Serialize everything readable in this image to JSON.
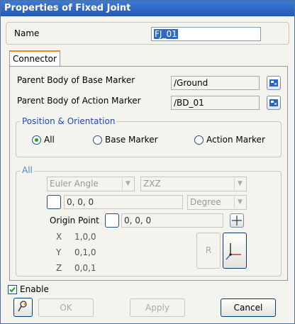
{
  "window": {
    "title": "Properties of Fixed Joint"
  },
  "name_label": "Name",
  "name_value": "FJ_01",
  "tab": "Connector",
  "parent_base_label": "Parent Body of Base Marker",
  "parent_base_value": "/Ground",
  "parent_action_label": "Parent Body of Action Marker",
  "parent_action_value": "/BD_01",
  "position_group": "Position & Orientation",
  "radio_all": "All",
  "radio_base": "Base Marker",
  "radio_action": "Action Marker",
  "all_group": "All",
  "euler_select": "Euler Angle",
  "order_select": "ZXZ",
  "angles_value": "0, 0, 0",
  "unit_select": "Degree",
  "origin_label": "Origin Point",
  "origin_value": "0, 0, 0",
  "axis_x_label": "X",
  "axis_x_value": "1,0,0",
  "axis_y_label": "Y",
  "axis_y_value": "0,1,0",
  "axis_z_label": "Z",
  "axis_z_value": "0,0,1",
  "r_button": "R",
  "enable_label": "Enable",
  "ok_button": "OK",
  "apply_button": "Apply",
  "cancel_button": "Cancel",
  "icons": [
    "browse-icon",
    "crosshair-icon",
    "coordinate-axes-icon",
    "pin-icon",
    "checkmark-icon",
    "chevron-down-icon"
  ]
}
